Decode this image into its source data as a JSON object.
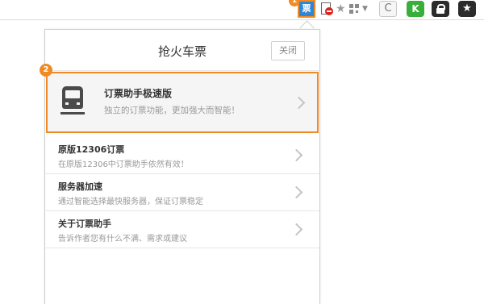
{
  "toolbar": {
    "step_one_badge": "1",
    "ticket_extension_label": "票",
    "refresh_glyph": "C",
    "k_extension_label": "K",
    "favorite_glyph": "★",
    "star_glyph": "★",
    "dropdown_glyph": "▼"
  },
  "popup": {
    "title": "抢火车票",
    "close_label": "关闭",
    "featured": {
      "badge": "2",
      "title": "订票助手极速版",
      "subtitle": "独立的订票功能，更加强大而智能！",
      "icon": "train-icon"
    },
    "items": [
      {
        "title": "原版12306订票",
        "subtitle": "在原版12306中订票助手依然有效！"
      },
      {
        "title": "服务器加速",
        "subtitle": "通过智能选择最快服务器，保证订票稳定"
      },
      {
        "title": "关于订票助手",
        "subtitle": "告诉作者您有什么不满、需求或建议"
      }
    ]
  },
  "colors": {
    "highlight_orange": "#f08a24",
    "ticket_blue": "#2d86d6",
    "k_green": "#3aae3a"
  }
}
